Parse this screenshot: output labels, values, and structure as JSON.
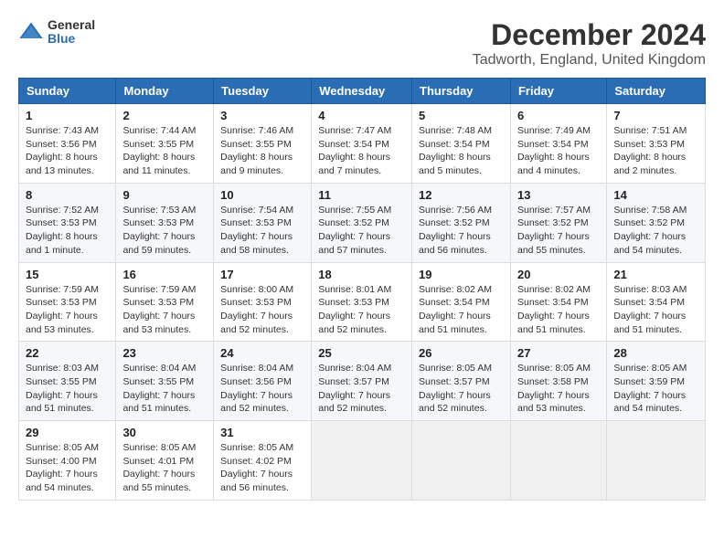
{
  "logo": {
    "general": "General",
    "blue": "Blue"
  },
  "header": {
    "month": "December 2024",
    "location": "Tadworth, England, United Kingdom"
  },
  "weekdays": [
    "Sunday",
    "Monday",
    "Tuesday",
    "Wednesday",
    "Thursday",
    "Friday",
    "Saturday"
  ],
  "weeks": [
    [
      {
        "day": "1",
        "info": "Sunrise: 7:43 AM\nSunset: 3:56 PM\nDaylight: 8 hours\nand 13 minutes."
      },
      {
        "day": "2",
        "info": "Sunrise: 7:44 AM\nSunset: 3:55 PM\nDaylight: 8 hours\nand 11 minutes."
      },
      {
        "day": "3",
        "info": "Sunrise: 7:46 AM\nSunset: 3:55 PM\nDaylight: 8 hours\nand 9 minutes."
      },
      {
        "day": "4",
        "info": "Sunrise: 7:47 AM\nSunset: 3:54 PM\nDaylight: 8 hours\nand 7 minutes."
      },
      {
        "day": "5",
        "info": "Sunrise: 7:48 AM\nSunset: 3:54 PM\nDaylight: 8 hours\nand 5 minutes."
      },
      {
        "day": "6",
        "info": "Sunrise: 7:49 AM\nSunset: 3:54 PM\nDaylight: 8 hours\nand 4 minutes."
      },
      {
        "day": "7",
        "info": "Sunrise: 7:51 AM\nSunset: 3:53 PM\nDaylight: 8 hours\nand 2 minutes."
      }
    ],
    [
      {
        "day": "8",
        "info": "Sunrise: 7:52 AM\nSunset: 3:53 PM\nDaylight: 8 hours\nand 1 minute."
      },
      {
        "day": "9",
        "info": "Sunrise: 7:53 AM\nSunset: 3:53 PM\nDaylight: 7 hours\nand 59 minutes."
      },
      {
        "day": "10",
        "info": "Sunrise: 7:54 AM\nSunset: 3:53 PM\nDaylight: 7 hours\nand 58 minutes."
      },
      {
        "day": "11",
        "info": "Sunrise: 7:55 AM\nSunset: 3:52 PM\nDaylight: 7 hours\nand 57 minutes."
      },
      {
        "day": "12",
        "info": "Sunrise: 7:56 AM\nSunset: 3:52 PM\nDaylight: 7 hours\nand 56 minutes."
      },
      {
        "day": "13",
        "info": "Sunrise: 7:57 AM\nSunset: 3:52 PM\nDaylight: 7 hours\nand 55 minutes."
      },
      {
        "day": "14",
        "info": "Sunrise: 7:58 AM\nSunset: 3:52 PM\nDaylight: 7 hours\nand 54 minutes."
      }
    ],
    [
      {
        "day": "15",
        "info": "Sunrise: 7:59 AM\nSunset: 3:53 PM\nDaylight: 7 hours\nand 53 minutes."
      },
      {
        "day": "16",
        "info": "Sunrise: 7:59 AM\nSunset: 3:53 PM\nDaylight: 7 hours\nand 53 minutes."
      },
      {
        "day": "17",
        "info": "Sunrise: 8:00 AM\nSunset: 3:53 PM\nDaylight: 7 hours\nand 52 minutes."
      },
      {
        "day": "18",
        "info": "Sunrise: 8:01 AM\nSunset: 3:53 PM\nDaylight: 7 hours\nand 52 minutes."
      },
      {
        "day": "19",
        "info": "Sunrise: 8:02 AM\nSunset: 3:54 PM\nDaylight: 7 hours\nand 51 minutes."
      },
      {
        "day": "20",
        "info": "Sunrise: 8:02 AM\nSunset: 3:54 PM\nDaylight: 7 hours\nand 51 minutes."
      },
      {
        "day": "21",
        "info": "Sunrise: 8:03 AM\nSunset: 3:54 PM\nDaylight: 7 hours\nand 51 minutes."
      }
    ],
    [
      {
        "day": "22",
        "info": "Sunrise: 8:03 AM\nSunset: 3:55 PM\nDaylight: 7 hours\nand 51 minutes."
      },
      {
        "day": "23",
        "info": "Sunrise: 8:04 AM\nSunset: 3:55 PM\nDaylight: 7 hours\nand 51 minutes."
      },
      {
        "day": "24",
        "info": "Sunrise: 8:04 AM\nSunset: 3:56 PM\nDaylight: 7 hours\nand 52 minutes."
      },
      {
        "day": "25",
        "info": "Sunrise: 8:04 AM\nSunset: 3:57 PM\nDaylight: 7 hours\nand 52 minutes."
      },
      {
        "day": "26",
        "info": "Sunrise: 8:05 AM\nSunset: 3:57 PM\nDaylight: 7 hours\nand 52 minutes."
      },
      {
        "day": "27",
        "info": "Sunrise: 8:05 AM\nSunset: 3:58 PM\nDaylight: 7 hours\nand 53 minutes."
      },
      {
        "day": "28",
        "info": "Sunrise: 8:05 AM\nSunset: 3:59 PM\nDaylight: 7 hours\nand 54 minutes."
      }
    ],
    [
      {
        "day": "29",
        "info": "Sunrise: 8:05 AM\nSunset: 4:00 PM\nDaylight: 7 hours\nand 54 minutes."
      },
      {
        "day": "30",
        "info": "Sunrise: 8:05 AM\nSunset: 4:01 PM\nDaylight: 7 hours\nand 55 minutes."
      },
      {
        "day": "31",
        "info": "Sunrise: 8:05 AM\nSunset: 4:02 PM\nDaylight: 7 hours\nand 56 minutes."
      },
      null,
      null,
      null,
      null
    ]
  ]
}
